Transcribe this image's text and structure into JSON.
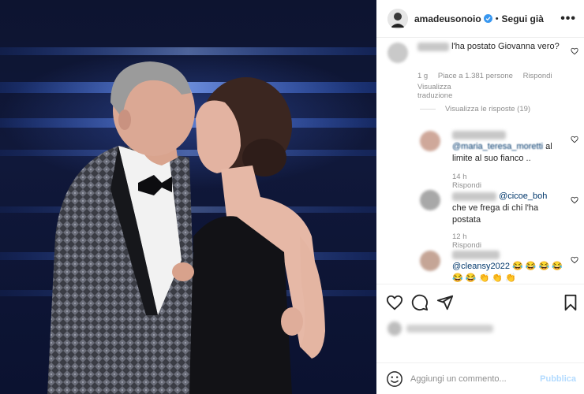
{
  "header": {
    "username": "amadeusonoio",
    "separator": "•",
    "follow_label": "Segui già",
    "more_label": "•••"
  },
  "comments": [
    {
      "text": "l'ha postato Giovanna vero?",
      "time": "1 g",
      "likes": "Piace a 1.381 persone",
      "reply": "Rispondi",
      "translate": "Visualizza traduzione",
      "view_replies": "Visualizza le risposte (19)"
    },
    {
      "mention": "@maria_teresa_moretti",
      "text": " al limite al suo fianco ..",
      "time": "14 h",
      "reply": "Rispondi"
    },
    {
      "mention": "@cicoe_boh",
      "text": "che ve frega di chi l'ha postata",
      "time": "12 h",
      "reply": "Rispondi"
    },
    {
      "mention": "@cleansy2022",
      "text": " 😂 😂 😂 😂 😂 😂 👏 👏 👏"
    }
  ],
  "add_comment": {
    "placeholder": "Aggiungi un commento...",
    "publish_label": "Pubblica"
  },
  "colors": {
    "verified": "#3897f0",
    "link": "#00376b",
    "muted": "#8e8e8e",
    "publish_disabled": "#b3dbff"
  },
  "icons": [
    "verified-badge-icon",
    "heart-icon",
    "comment-icon",
    "share-icon",
    "bookmark-icon",
    "emoji-icon"
  ]
}
